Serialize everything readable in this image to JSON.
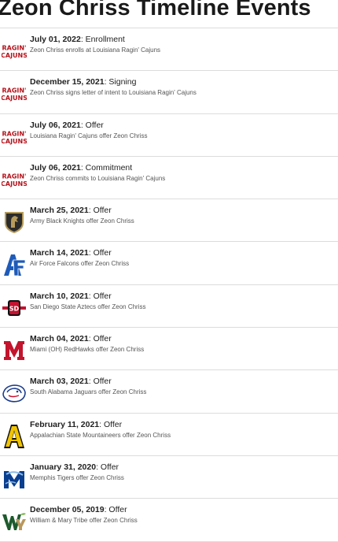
{
  "page": {
    "title": "Zeon Chriss Timeline Events"
  },
  "events": [
    {
      "date": "July 01, 2022",
      "kind": "Enrollment",
      "desc": "Zeon Chriss enrolls at Louisiana Ragin' Cajuns",
      "team": "Louisiana Ragin' Cajuns",
      "logo": "ragin-cajuns-logo"
    },
    {
      "date": "December 15, 2021",
      "kind": "Signing",
      "desc": "Zeon Chriss signs letter of intent to Louisiana Ragin' Cajuns",
      "team": "Louisiana Ragin' Cajuns",
      "logo": "ragin-cajuns-logo"
    },
    {
      "date": "July 06, 2021",
      "kind": "Offer",
      "desc": "Louisiana Ragin' Cajuns offer Zeon Chriss",
      "team": "Louisiana Ragin' Cajuns",
      "logo": "ragin-cajuns-logo"
    },
    {
      "date": "July 06, 2021",
      "kind": "Commitment",
      "desc": "Zeon Chriss commits to Louisiana Ragin' Cajuns",
      "team": "Louisiana Ragin' Cajuns",
      "logo": "ragin-cajuns-logo"
    },
    {
      "date": "March 25, 2021",
      "kind": "Offer",
      "desc": "Army Black Knights offer Zeon Chriss",
      "team": "Army Black Knights",
      "logo": "army-knight-logo"
    },
    {
      "date": "March 14, 2021",
      "kind": "Offer",
      "desc": "Air Force Falcons offer Zeon Chriss",
      "team": "Air Force Falcons",
      "logo": "air-force-logo"
    },
    {
      "date": "March 10, 2021",
      "kind": "Offer",
      "desc": "San Diego State Aztecs offer Zeon Chriss",
      "team": "San Diego State Aztecs",
      "logo": "sdsu-logo"
    },
    {
      "date": "March 04, 2021",
      "kind": "Offer",
      "desc": "Miami (OH) RedHawks offer Zeon Chriss",
      "team": "Miami (OH) RedHawks",
      "logo": "miami-oh-logo"
    },
    {
      "date": "March 03, 2021",
      "kind": "Offer",
      "desc": "South Alabama Jaguars offer Zeon Chriss",
      "team": "South Alabama Jaguars",
      "logo": "south-alabama-logo"
    },
    {
      "date": "February 11, 2021",
      "kind": "Offer",
      "desc": "Appalachian State Mountaineers offer Zeon Chriss",
      "team": "Appalachian State Mountaineers",
      "logo": "app-state-logo"
    },
    {
      "date": "January 31, 2020",
      "kind": "Offer",
      "desc": "Memphis Tigers offer Zeon Chriss",
      "team": "Memphis Tigers",
      "logo": "memphis-logo"
    },
    {
      "date": "December 05, 2019",
      "kind": "Offer",
      "desc": "William & Mary Tribe offer Zeon Chriss",
      "team": "William & Mary Tribe",
      "logo": "william-mary-logo"
    }
  ],
  "colors": {
    "ragin_cajuns": "#b5121b",
    "army": "#2b2b2b",
    "army_gold": "#b69b5c",
    "air_force": "#1e5bb8",
    "sdsu": "#c41230",
    "miami_oh": "#c3142d",
    "south_alabama": "#1b3c8c",
    "app_state": "#f1c400",
    "memphis": "#0a3e8f",
    "william_mary": "#1d5a2c",
    "william_mary_gold": "#b9975b",
    "divider": "#dcdcdc"
  }
}
